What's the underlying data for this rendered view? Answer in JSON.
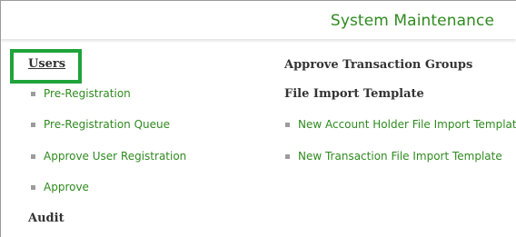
{
  "header": {
    "title": "System Maintenance"
  },
  "left_column": {
    "users_label": "Users",
    "items": [
      {
        "label": "Pre-Registration"
      },
      {
        "label": "Pre-Registration Queue"
      },
      {
        "label": "Approve User Registration"
      },
      {
        "label": "Approve"
      }
    ],
    "audit_label": "Audit"
  },
  "right_column": {
    "approve_groups_label": "Approve Transaction Groups",
    "file_import_label": "File Import Template",
    "items": [
      {
        "label": "New Account Holder File Import Template"
      },
      {
        "label": "New Transaction File Import Template"
      }
    ]
  },
  "colors": {
    "link_green": "#2f8a1f",
    "highlight_green": "#1fa33a",
    "bullet_gray": "#9c9c9c",
    "text_dark": "#333333"
  },
  "icons": {
    "bullet": "square-bullet-icon"
  }
}
